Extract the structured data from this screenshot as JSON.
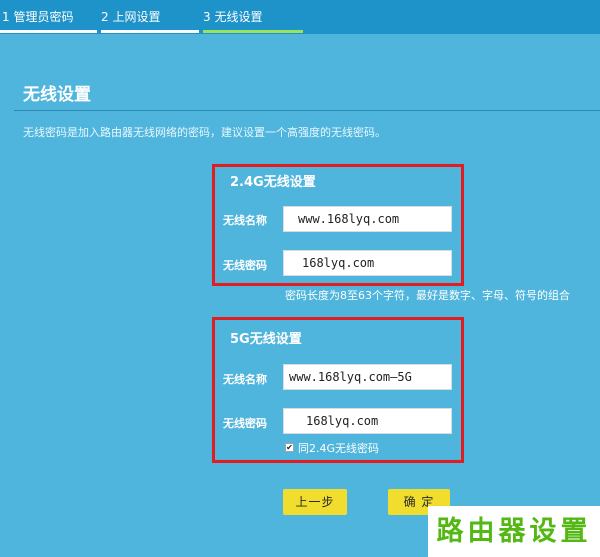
{
  "steps": [
    {
      "label": "1 管理员密码",
      "active": false
    },
    {
      "label": "2 上网设置",
      "active": false
    },
    {
      "label": "3 无线设置",
      "active": true
    }
  ],
  "page": {
    "title": "无线设置",
    "description": "无线密码是加入路由器无线网络的密码，建议设置一个高强度的无线密码。"
  },
  "band24": {
    "heading": "2.4G无线设置",
    "name_label": "无线名称",
    "name_value": "www.168lyq.com",
    "password_label": "无线密码",
    "password_value": "168lyq.com",
    "hint": "密码长度为8至63个字符，最好是数字、字母、符号的组合"
  },
  "band5": {
    "heading": "5G无线设置",
    "name_label": "无线名称",
    "name_value": "www.168lyq.com—5G",
    "password_label": "无线密码",
    "password_value": "168lyq.com",
    "same_password_label": "同2.4G无线密码",
    "same_password_checked": true
  },
  "buttons": {
    "prev": "上一步",
    "confirm": "确 定"
  },
  "watermark": "路由器设置",
  "colors": {
    "background": "#4fb5dc",
    "step_bar": "#1e93c9",
    "active_step": "#9be35a",
    "highlight_border": "#e21d22",
    "button": "#f1dd2e",
    "watermark_text": "#53b814"
  }
}
